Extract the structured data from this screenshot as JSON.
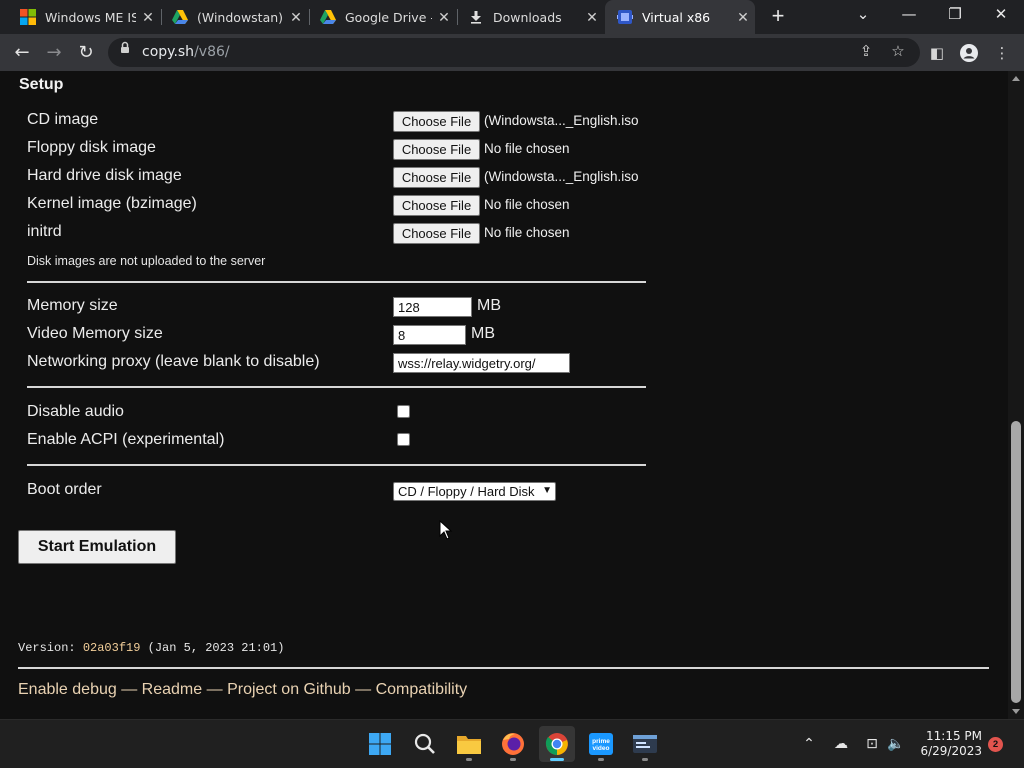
{
  "browser": {
    "tabs": [
      {
        "title": "Windows ME IS(",
        "icon": "windows-icon"
      },
      {
        "title": "(Windowstan) W",
        "icon": "google-drive-icon"
      },
      {
        "title": "Google Drive - V",
        "icon": "google-drive-icon"
      },
      {
        "title": "Downloads",
        "icon": "download-icon"
      },
      {
        "title": "Virtual x86",
        "icon": "v86-icon"
      }
    ],
    "url_host": "copy.sh",
    "url_path": "/v86/"
  },
  "page": {
    "setup_title": "Setup",
    "cd_image": {
      "label": "CD image",
      "button": "Choose File",
      "file": "(Windowsta..._English.iso"
    },
    "floppy": {
      "label": "Floppy disk image",
      "button": "Choose File",
      "file": "No file chosen"
    },
    "hard_drive": {
      "label": "Hard drive disk image",
      "button": "Choose File",
      "file": "(Windowsta..._English.iso"
    },
    "kernel": {
      "label": "Kernel image (bzimage)",
      "button": "Choose File",
      "file": "No file chosen"
    },
    "initrd": {
      "label": "initrd",
      "button": "Choose File",
      "file": "No file chosen"
    },
    "disk_note": "Disk images are not uploaded to the server",
    "memory": {
      "label": "Memory size",
      "value": "128",
      "unit": "MB"
    },
    "video_memory": {
      "label": "Video Memory size",
      "value": "8",
      "unit": "MB"
    },
    "network_proxy": {
      "label": "Networking proxy (leave blank to disable)",
      "value": "wss://relay.widgetry.org/"
    },
    "disable_audio": {
      "label": "Disable audio",
      "checked": false
    },
    "enable_acpi": {
      "label": "Enable ACPI (experimental)",
      "checked": false
    },
    "boot_order": {
      "label": "Boot order",
      "selected": "CD / Floppy / Hard Disk"
    },
    "start_button": "Start Emulation",
    "version_prefix": "Version: ",
    "version_hash": "02a03f19",
    "version_date": " (Jan 5, 2023 21:01)",
    "footer_links": [
      "Enable debug",
      "Readme",
      "Project on Github",
      "Compatibility"
    ],
    "footer_separator": "—"
  },
  "taskbar": {
    "apps": [
      "start-icon",
      "search-icon",
      "file-explorer-icon",
      "firefox-icon",
      "chrome-icon",
      "prime-video-icon",
      "terminal-icon"
    ],
    "active_app": "chrome-icon",
    "time": "11:15 PM",
    "date": "6/29/2023",
    "notifications": "2"
  }
}
